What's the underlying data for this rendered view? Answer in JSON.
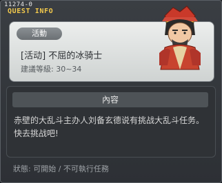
{
  "window": {
    "quest_id": "11274-0",
    "title": "QUEST INFO"
  },
  "header": {
    "tag": "活動",
    "quest_name": "[活动] 不屈的冰骑士",
    "level_req": "建議等級: 30~34",
    "portrait_icon": "npc-portrait-icon"
  },
  "content": {
    "header": "內容",
    "text": "赤壁的大乱斗主办人刘备玄德说有挑战大乱斗任务。快去挑战吧!"
  },
  "status": "狀態: 可開始 / 不可執行任務",
  "colors": {
    "title": "#f2c94c",
    "panel_light": "#e0e3e2",
    "panel_dark": "#2f3236"
  }
}
